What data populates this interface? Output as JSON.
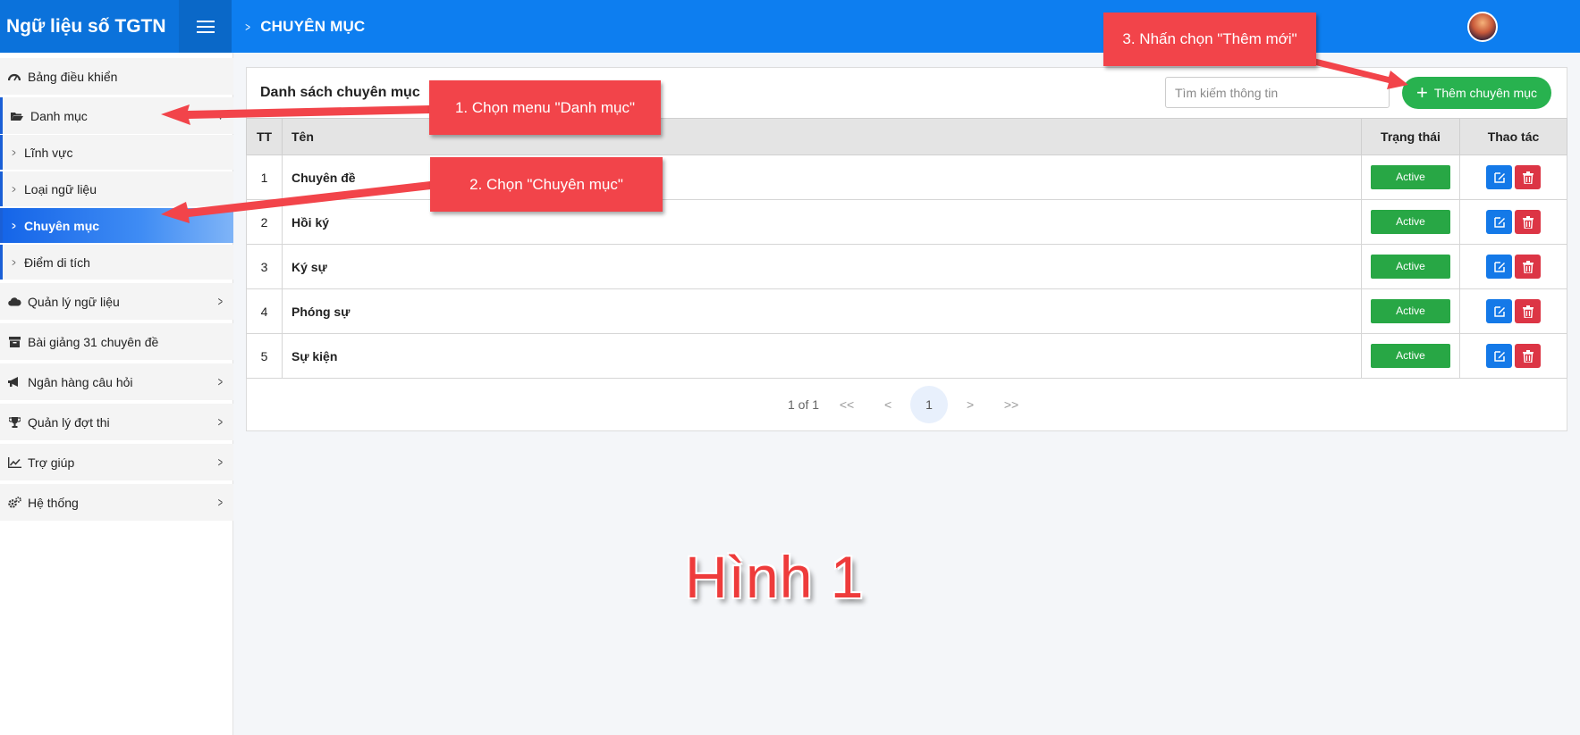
{
  "header": {
    "brand": "Ngữ liệu số TGTN",
    "breadcrumb": "CHUYÊN MỤC"
  },
  "sidebar": {
    "items": [
      {
        "label": "Bảng điều khiển",
        "icon": "dashboard-icon"
      },
      {
        "label": "Danh mục",
        "icon": "folder-open-icon"
      },
      {
        "label": "Lĩnh vực"
      },
      {
        "label": "Loại ngữ liệu"
      },
      {
        "label": "Chuyên mục"
      },
      {
        "label": "Điểm di tích"
      },
      {
        "label": "Quản lý ngữ liệu",
        "icon": "cloud-icon"
      },
      {
        "label": "Bài giảng 31 chuyên đề",
        "icon": "archive-icon"
      },
      {
        "label": "Ngân hàng câu hỏi",
        "icon": "megaphone-icon"
      },
      {
        "label": "Quản lý đợt thi",
        "icon": "trophy-icon"
      },
      {
        "label": "Trợ giúp",
        "icon": "line-chart-icon"
      },
      {
        "label": "Hệ thống",
        "icon": "cogs-icon"
      }
    ]
  },
  "main": {
    "title": "Danh sách chuyên mục",
    "search_placeholder": "Tìm kiếm thông tin",
    "add_label": "Thêm chuyên mục",
    "columns": {
      "tt": "TT",
      "name": "Tên",
      "status": "Trạng thái",
      "actions": "Thao tác"
    },
    "rows": [
      {
        "tt": "1",
        "name": "Chuyên đề",
        "status": "Active"
      },
      {
        "tt": "2",
        "name": "Hồi ký",
        "status": "Active"
      },
      {
        "tt": "3",
        "name": "Ký sự",
        "status": "Active"
      },
      {
        "tt": "4",
        "name": "Phóng sự",
        "status": "Active"
      },
      {
        "tt": "5",
        "name": "Sự kiện",
        "status": "Active"
      }
    ],
    "pagination": {
      "info": "1 of 1",
      "first": "<<",
      "prev": "<",
      "current": "1",
      "next": ">",
      "last": ">>"
    }
  },
  "annotations": {
    "step1": "1. Chọn menu \"Danh mục\"",
    "step2": "2. Chọn \"Chuyên mục\"",
    "step3": "3. Nhấn chọn \"Thêm mới\"",
    "figure": "Hình 1"
  },
  "colors": {
    "header": "#0d7ef0",
    "active_gradient_start": "#1565e8",
    "add_button": "#28b24f",
    "status_active": "#28a745",
    "edit_button": "#1479e8",
    "delete_button": "#dc3545",
    "callout": "#f2444a"
  }
}
